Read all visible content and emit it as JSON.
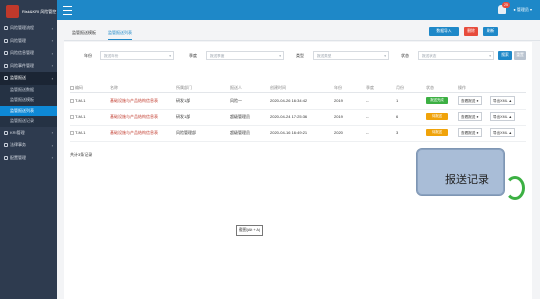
{
  "app": {
    "logo_text": "Risk&KRI 风险管控"
  },
  "topbar": {
    "notif_count": "25",
    "user_label": "管理员"
  },
  "sidebar": {
    "items": [
      {
        "label": "风险管理流程",
        "active": false
      },
      {
        "label": "风险管理",
        "active": false
      },
      {
        "label": "风险信息管理",
        "active": false
      },
      {
        "label": "风险事件管理",
        "active": false
      },
      {
        "label": "监管报送",
        "active": true
      },
      {
        "label": "KRI管理",
        "active": false
      },
      {
        "label": "法律事务",
        "active": false
      },
      {
        "label": "配置管理",
        "active": false
      }
    ],
    "subitems": [
      {
        "label": "监管报送数据",
        "active": false
      },
      {
        "label": "监管报送模板",
        "active": false
      },
      {
        "label": "监管报送列表",
        "active": true
      },
      {
        "label": "监管报送记录",
        "active": false
      }
    ]
  },
  "tabs": [
    {
      "label": "监管报送模板"
    },
    {
      "label": "监管报送列表"
    }
  ],
  "actions": {
    "import": "数据导入",
    "delete": "删除",
    "refresh": "刷新",
    "search": "搜索",
    "reset": "重置"
  },
  "filters": [
    {
      "label": "年份",
      "placeholder": "报送年份"
    },
    {
      "label": "季度",
      "placeholder": "报送季度"
    },
    {
      "label": "类型",
      "placeholder": "报送类型"
    },
    {
      "label": "状态",
      "placeholder": "报送状态"
    }
  ],
  "table": {
    "headers": [
      "编码",
      "名称",
      "所属部门",
      "报送人",
      "创建时间",
      "年份",
      "季度",
      "月份",
      "状态",
      "操作"
    ],
    "rows": [
      {
        "code": "T-M-1",
        "name": "基础设施与产品结构信息表",
        "dept": "研发1部",
        "reporter": "风险一",
        "time": "2020-04-26 16:34:42",
        "year": "2019",
        "quarter": "--",
        "month": "1",
        "status": "报送完成",
        "status_color": "#3cb043"
      },
      {
        "code": "T-M-1",
        "name": "基础设施与产品结构信息表",
        "dept": "研发1部",
        "reporter": "超级管理员",
        "time": "2020-04-24 17:25:36",
        "year": "2019",
        "quarter": "--",
        "month": "6",
        "status": "待报送",
        "status_color": "#f0a30a"
      },
      {
        "code": "T-M-1",
        "name": "基础设施与产品结构信息表",
        "dept": "风险管理部",
        "reporter": "超级管理员",
        "time": "2020-04-16 16:49:21",
        "year": "2020",
        "quarter": "--",
        "month": "3",
        "status": "待报送",
        "status_color": "#f0a30a"
      }
    ],
    "op_view": "查看报送 ●",
    "op_export": "导出XML ▲"
  },
  "footer": {
    "total": "共计3条记录"
  },
  "callout": {
    "text": "报送记录"
  },
  "screenshot_hint": {
    "text": "截图(Alt + A)"
  }
}
